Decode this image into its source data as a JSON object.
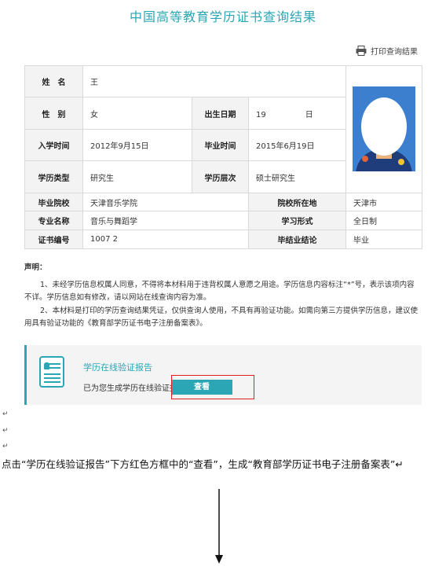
{
  "page": {
    "title": "中国高等教育学历证书查询结果",
    "print_label": "打印查询结果"
  },
  "info": {
    "name_label": "姓　名",
    "name_value": "王",
    "gender_label": "性　别",
    "gender_value": "女",
    "birth_label": "出生日期",
    "birth_value": "19　　　　　日",
    "enroll_label": "入学时间",
    "enroll_value": "2012年9月15日",
    "grad_time_label": "毕业时间",
    "grad_time_value": "2015年6月19日",
    "edu_type_label": "学历类型",
    "edu_type_value": "研究生",
    "edu_level_label": "学历层次",
    "edu_level_value": "硕士研究生",
    "school_label": "毕业院校",
    "school_value": "天津音乐学院",
    "location_label": "院校所在地",
    "location_value": "天津市",
    "major_label": "专业名称",
    "major_value": "音乐与舞蹈学",
    "study_form_label": "学习形式",
    "study_form_value": "全日制",
    "cert_no_label": "证书编号",
    "cert_no_value": "1007 2",
    "conclusion_label": "毕结业结论",
    "conclusion_value": "毕业"
  },
  "statement": {
    "title": "声明：",
    "p1": "1、未经学历信息权属人同意，不得将本材料用于违背权属人意愿之用途。学历信息内容标注“*”号，表示该项内容不详。学历信息如有修改，请以网站在线查询内容为准。",
    "p2": "2、本材料是打印的学历查询结果凭证，仅供查询人使用，不具有再验证功能。如需向第三方提供学历信息，建议使用具有验证功能的《教育部学历证书电子注册备案表》。"
  },
  "verify": {
    "title": "学历在线验证报告",
    "text": "已为您生成学历在线验证报告。",
    "button_label": "查看"
  },
  "doc": {
    "para_mark": "↵",
    "instruction": "点击“学历在线验证报告”下方红色方框中的“查看”，生成“教育部学历证书电子注册备案表”↵"
  },
  "colors": {
    "accent": "#2aa6b4",
    "highlight_border": "#e02020"
  }
}
